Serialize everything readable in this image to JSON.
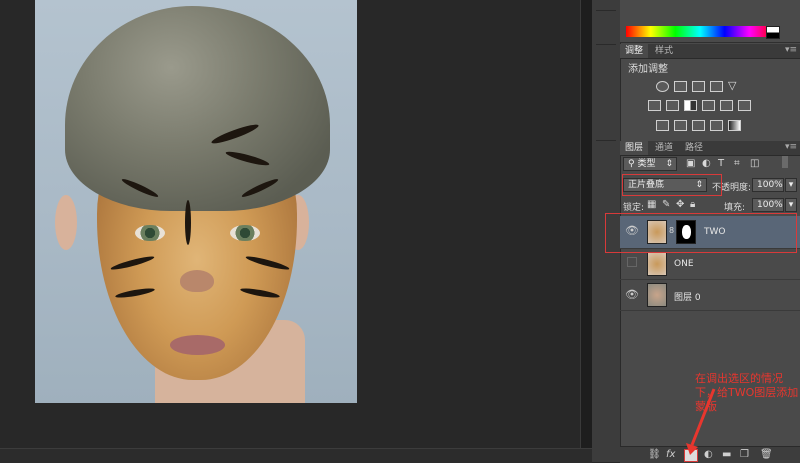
{
  "adjust_panel": {
    "tabs": [
      "调整",
      "样式"
    ],
    "title": "添加调整"
  },
  "layers_panel": {
    "tabs": [
      "图层",
      "通道",
      "路径"
    ],
    "filter_kind": "类型",
    "blend_mode": "正片叠底",
    "opacity_label": "不透明度:",
    "opacity_value": "100%",
    "lock_label": "锁定:",
    "fill_label": "填充:",
    "fill_value": "100%",
    "layers": [
      {
        "name": "TWO",
        "visible": true,
        "selected": true,
        "has_mask": true
      },
      {
        "name": "ONE",
        "visible": false,
        "selected": false,
        "has_mask": false
      },
      {
        "name": "图层 0",
        "visible": true,
        "selected": false,
        "has_mask": false
      }
    ]
  },
  "annotation": {
    "text": "在调出选区的情况下，给TWO图层添加蒙版"
  },
  "colors": {
    "panel_bg": "#4a4a4a",
    "selected_row": "#596677",
    "highlight": "#d83a3a"
  }
}
